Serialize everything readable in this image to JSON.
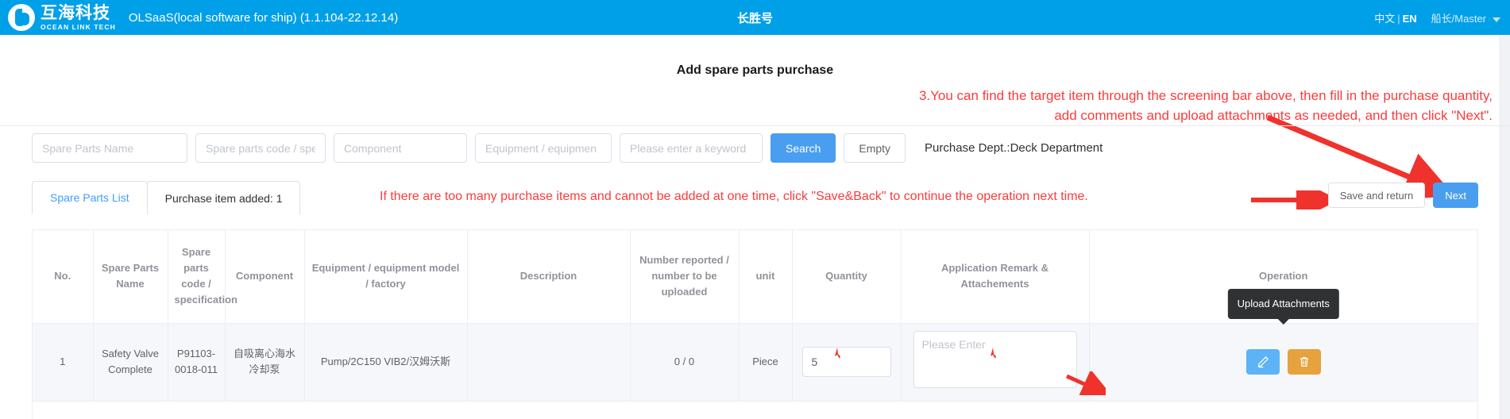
{
  "header": {
    "logo_cn": "互海科技",
    "logo_en": "OCEAN LINK TECH",
    "app_title": "OLSaaS(local software for ship)  (1.1.104-22.12.14)",
    "ship_name": "长胜号",
    "lang_cn": "中文",
    "lang_sep": "|",
    "lang_en": "EN",
    "user": "船长/Master",
    "brand_color": "#00a0e9"
  },
  "page": {
    "title": "Add spare parts purchase"
  },
  "annotations": {
    "top_line1": "3.You can find the target item through the screening bar above, then fill in the purchase quantity,",
    "top_line2": "add comments and upload attachments as needed, and then click \"Next\".",
    "tabs_note": "If there are too many purchase items and cannot be added at one time, click \"Save&Back\" to continue the operation next time.",
    "color": "#fb3b3b"
  },
  "filters": {
    "spare_parts_name_placeholder": "Spare Parts Name",
    "spare_parts_name_value": "",
    "spare_parts_code_placeholder": "Spare parts code / spe",
    "spare_parts_code_value": "",
    "component_placeholder": "Component",
    "component_value": "",
    "equipment_placeholder": "Equipment / equipmen",
    "equipment_value": "",
    "keyword_placeholder": "Please enter a keyword",
    "keyword_value": "",
    "search_label": "Search",
    "empty_label": "Empty",
    "purchase_dept": "Purchase Dept.:Deck Department"
  },
  "tabs": {
    "items": [
      {
        "label": "Spare Parts List",
        "active": true
      },
      {
        "label": "Purchase item added: 1",
        "active": false
      }
    ],
    "save_and_return_label": "Save and return",
    "next_label": "Next"
  },
  "table": {
    "columns": [
      "No.",
      "Spare Parts Name",
      "Spare parts code / specification",
      "Component",
      "Equipment / equipment model / factory",
      "Description",
      "Number reported / number to be uploaded",
      "unit",
      "Quantity",
      "Application Remark & Attachements",
      "Operation"
    ],
    "rows": [
      {
        "no": "1",
        "spare_parts_name": "Safety Valve Complete",
        "spare_parts_code": "P91103-0018-011",
        "component": "自吸离心海水冷却泵",
        "equipment": "Pump/2C150 VIB2/汉姆沃斯",
        "description": "",
        "number_reported": "0 / 0",
        "unit": "Piece",
        "quantity_value": "5",
        "remark_placeholder": "Please Enter",
        "remark_value": ""
      }
    ],
    "tooltip": "Upload Attachments",
    "edit_icon": "pencil-icon",
    "delete_icon": "trash-icon"
  }
}
